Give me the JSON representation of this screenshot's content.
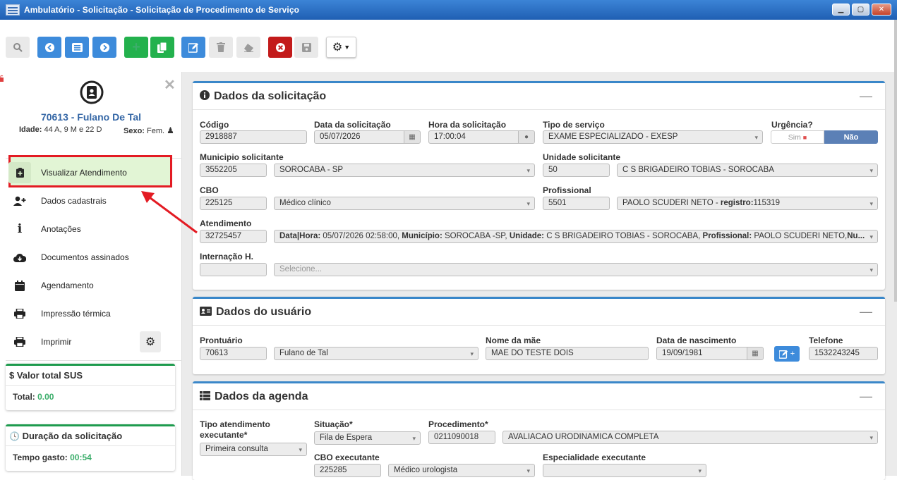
{
  "window": {
    "title": "Ambulatório - Solicitação - Solicitação de Procedimento de Serviço"
  },
  "patient": {
    "id_name": "70613 - Fulano De Tal",
    "age_label": "Idade:",
    "age_value": "44 A, 9 M e 22 D",
    "sex_label": "Sexo:",
    "sex_value": "Fem."
  },
  "menu": [
    {
      "label": "Visualizar Atendimento",
      "icon": "clipboard-plus-icon"
    },
    {
      "label": "Dados cadastrais",
      "icon": "user-plus-icon"
    },
    {
      "label": "Anotações",
      "icon": "info-icon"
    },
    {
      "label": "Documentos assinados",
      "icon": "cloud-download-icon"
    },
    {
      "label": "Agendamento",
      "icon": "calendar-icon"
    },
    {
      "label": "Impressão térmica",
      "icon": "printer-icon"
    },
    {
      "label": "Imprimir",
      "icon": "printer-icon"
    }
  ],
  "valor_box": {
    "title": "$ Valor total SUS",
    "total_label": "Total:",
    "total_value": "0.00"
  },
  "duracao_box": {
    "title": "Duração da solicitação",
    "tempo_label": "Tempo gasto:",
    "tempo_value": "00:54"
  },
  "solicitacao": {
    "title": "Dados da solicitação",
    "codigo_label": "Código",
    "codigo": "2918887",
    "data_label": "Data da solicitação",
    "data": "05/07/2026",
    "hora_label": "Hora da solicitação",
    "hora": "17:00:04",
    "tipo_label": "Tipo de serviço",
    "tipo": "EXAME ESPECIALIZADO - EXESP",
    "urgencia_label": "Urgência?",
    "urgencia_sim": "Sim",
    "urgencia_nao": "Não",
    "municipio_label": "Municipio solicitante",
    "municipio_codigo": "3552205",
    "municipio": "SOROCABA - SP",
    "unidade_label": "Unidade solicitante",
    "unidade_codigo": "50",
    "unidade": "C S BRIGADEIRO TOBIAS - SOROCABA",
    "cbo_label": "CBO",
    "cbo_codigo": "225125",
    "cbo": "Médico clínico",
    "profissional_label": "Profissional",
    "profissional_codigo": "5501",
    "profissional_nome": "PAOLO SCUDERI NETO - ",
    "profissional_reg_label": "registro:",
    "profissional_reg": "115319",
    "atendimento_label": "Atendimento",
    "atendimento_codigo": "32725457",
    "atendimento_desc": {
      "k1": "Data|Hora:",
      "v1": " 05/07/2026 02:58:00, ",
      "k2": "Município:",
      "v2": " SOROCABA -SP, ",
      "k3": "Unidade:",
      "v3": " C S BRIGADEIRO TOBIAS - SOROCABA, ",
      "k4": "Profissional:",
      "v4": " PAOLO SCUDERI NETO,",
      "k5": "Nu..."
    },
    "internacao_label": "Internação H.",
    "internacao_placeholder": "Selecione..."
  },
  "usuario": {
    "title": "Dados do usuário",
    "prontuario_label": "Prontuário",
    "prontuario": "70613",
    "nome": "Fulano de Tal",
    "mae_label": "Nome da mãe",
    "mae": "MAE DO TESTE DOIS",
    "nasc_label": "Data de nascimento",
    "nasc": "19/09/1981",
    "telefone_label": "Telefone",
    "telefone": "1532243245"
  },
  "agenda": {
    "title": "Dados da agenda",
    "tipo_label_1": "Tipo atendimento",
    "tipo_label_2": "executante*",
    "tipo": "Primeira consulta",
    "situacao_label": "Situação*",
    "situacao": "Fila de Espera",
    "procedimento_label": "Procedimento*",
    "procedimento_codigo": "0211090018",
    "procedimento": "AVALIACAO URODINAMICA COMPLETA",
    "cbo_label": "CBO executante",
    "cbo_codigo": "225285",
    "cbo": "Médico urologista",
    "especialidade_label": "Especialidade executante"
  },
  "colors": {
    "primary": "#3d8bdb",
    "success": "#23b14d",
    "danger": "#c31b1b",
    "highlight": "#e31b23"
  }
}
